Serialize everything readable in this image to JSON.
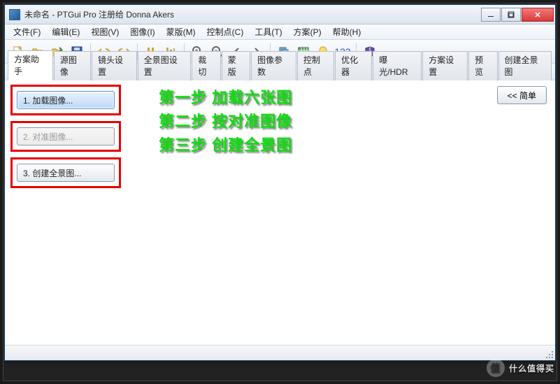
{
  "titlebar": {
    "title": "未命名 - PTGui Pro 注册给 Donna Akers"
  },
  "menus": [
    "文件(F)",
    "编辑(E)",
    "视图(V)",
    "图像(I)",
    "蒙版(M)",
    "控制点(C)",
    "工具(T)",
    "方案(P)",
    "帮助(H)"
  ],
  "toolbar": {
    "icons": [
      "new-file-icon",
      "open-folder-icon",
      "add-image-icon",
      "save-icon",
      "sep",
      "undo-icon",
      "redo-icon",
      "sep",
      "align-icon",
      "adjust-icon",
      "sep",
      "zoom-in-icon",
      "zoom-out-icon",
      "prev-icon",
      "next-icon",
      "sep",
      "copy-icon",
      "grid-icon",
      "bulb-icon",
      "numbers-icon",
      "sep",
      "help-book-icon"
    ],
    "num_label": "123"
  },
  "tabs": [
    {
      "label": "方案助手",
      "active": true
    },
    {
      "label": "源图像"
    },
    {
      "label": "镜头设置"
    },
    {
      "label": "全景图设置"
    },
    {
      "label": "裁切"
    },
    {
      "label": "蒙版"
    },
    {
      "label": "图像参数"
    },
    {
      "label": "控制点"
    },
    {
      "label": "优化器"
    },
    {
      "label": "曝光/HDR"
    },
    {
      "label": "方案设置"
    },
    {
      "label": "预览"
    },
    {
      "label": "创建全景图"
    }
  ],
  "steps": [
    {
      "label": "1. 加载图像...",
      "state": "primary"
    },
    {
      "label": "2. 对准图像...",
      "state": "disabled"
    },
    {
      "label": "3. 创建全景图...",
      "state": "normal"
    }
  ],
  "annotations": [
    "第一步 加载六张图",
    "第二步 按对准图像",
    "第三步 创建全景图"
  ],
  "simple_button": "<< 简单",
  "watermark": "什么值得买"
}
